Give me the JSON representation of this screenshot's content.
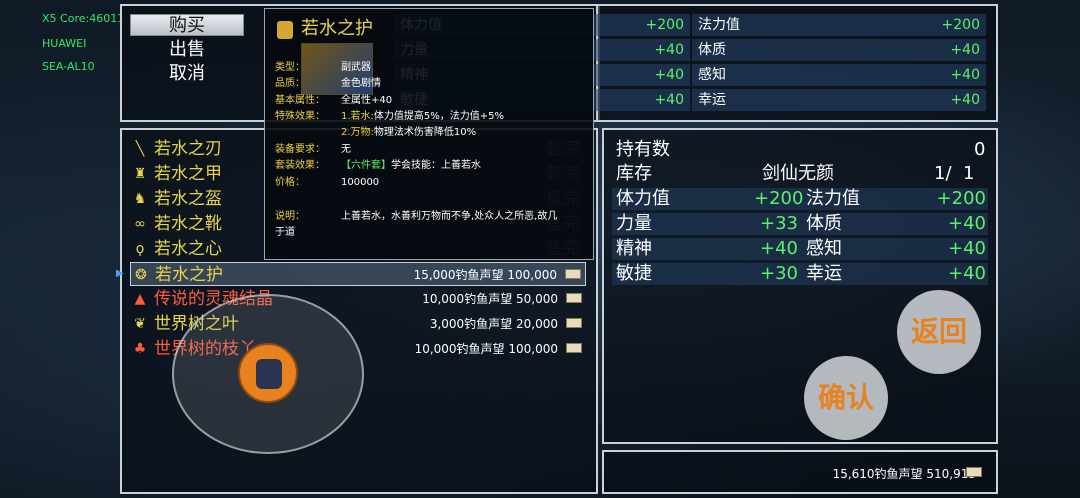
{
  "device": {
    "line1": "X5 Core:46011",
    "line2": "HUAWEI",
    "line3": "SEA-AL10"
  },
  "menu": {
    "buy": "购买",
    "sell": "出售",
    "cancel": "取消"
  },
  "top_stats": {
    "left": [
      {
        "label": "体力值",
        "value": "+200"
      },
      {
        "label": "力量",
        "value": "+40"
      },
      {
        "label": "精神",
        "value": "+40"
      },
      {
        "label": "敏捷",
        "value": "+40"
      }
    ],
    "right": [
      {
        "label": "法力值",
        "value": "+200"
      },
      {
        "label": "体质",
        "value": "+40"
      },
      {
        "label": "感知",
        "value": "+40"
      },
      {
        "label": "幸运",
        "value": "+40"
      }
    ]
  },
  "items": [
    {
      "icon": "sword-icon",
      "glyph": "╲",
      "name": "若水之刃",
      "color": "#e8d44a",
      "sold": "售完",
      "price": "",
      "selected": false
    },
    {
      "icon": "armor-icon",
      "glyph": "♜",
      "name": "若水之甲",
      "color": "#e8d44a",
      "sold": "售完",
      "price": "",
      "selected": false
    },
    {
      "icon": "helmet-icon",
      "glyph": "♞",
      "name": "若水之盔",
      "color": "#e8d44a",
      "sold": "售完",
      "price": "",
      "selected": false
    },
    {
      "icon": "boots-icon",
      "glyph": "∞",
      "name": "若水之靴",
      "color": "#e8d44a",
      "sold": "售完",
      "price": "",
      "selected": false
    },
    {
      "icon": "necklace-icon",
      "glyph": "ϙ",
      "name": "若水之心",
      "color": "#e8d44a",
      "sold": "售完",
      "price": "",
      "selected": false
    },
    {
      "icon": "shield-icon",
      "glyph": "❂",
      "name": "若水之护",
      "color": "#e8d44a",
      "sold": "",
      "price": "15,000钓鱼声望 100,000",
      "selected": true
    },
    {
      "icon": "crystal-icon",
      "glyph": "▲",
      "name": "传说的灵魂结晶",
      "color": "#ff5a3a",
      "sold": "",
      "price": "10,000钓鱼声望 50,000",
      "selected": false
    },
    {
      "icon": "leaf-icon",
      "glyph": "❦",
      "name": "世界树之叶",
      "color": "#e8d44a",
      "sold": "",
      "price": "3,000钓鱼声望 20,000",
      "selected": false
    },
    {
      "icon": "clover-icon",
      "glyph": "♣",
      "name": "世界树的枝丫",
      "color": "#ff5a3a",
      "sold": "",
      "price": "10,000钓鱼声望 100,000",
      "selected": false
    }
  ],
  "tooltip": {
    "title": "若水之护",
    "type_k": "类型：",
    "type_v": "副武器",
    "quality_k": "品质：",
    "quality_v": "金色剧情",
    "base_k": "基本属性：",
    "base_v": "全属性+40",
    "special_k": "特殊效果：",
    "special_1a": "1.若水:",
    "special_1b": "体力值提高5%，法力值+5%",
    "special_2a": "2.万物:",
    "special_2b": "物理法术伤害降低10%",
    "req_k": "装备要求：",
    "req_v": "无",
    "set_k": "套装效果：",
    "set_tag": "【六件套】",
    "set_v": "学会技能：上善若水",
    "price_k": "价格：",
    "price_v": "100000",
    "desc_k": "说明：",
    "desc_v1": "上善若水，水善利万物而不争,处众人之所恶,故几",
    "desc_v2": "于道"
  },
  "info": {
    "owned_label": "持有数",
    "owned_value": "0",
    "stock_label": "库存",
    "stock_hero": "剑仙无颜",
    "stock_value": "1/  1",
    "rows": [
      {
        "l_label": "体力值",
        "l_value": "+200",
        "r_label": "法力值",
        "r_value": "+200"
      },
      {
        "l_label": "力量",
        "l_value": "+33",
        "r_label": "体质",
        "r_value": "+40"
      },
      {
        "l_label": "精神",
        "l_value": "+40",
        "r_label": "感知",
        "r_value": "+40"
      },
      {
        "l_label": "敏捷",
        "l_value": "+30",
        "r_label": "幸运",
        "r_value": "+40"
      }
    ]
  },
  "wallet": {
    "text": "15,610钓鱼声望 510,915"
  },
  "buttons": {
    "back": "返回",
    "confirm": "确认"
  },
  "colors": {
    "green": "#5cf06a",
    "gold": "#e8d44a",
    "red": "#ff5a3a",
    "orange_btn": "#e8821e"
  }
}
